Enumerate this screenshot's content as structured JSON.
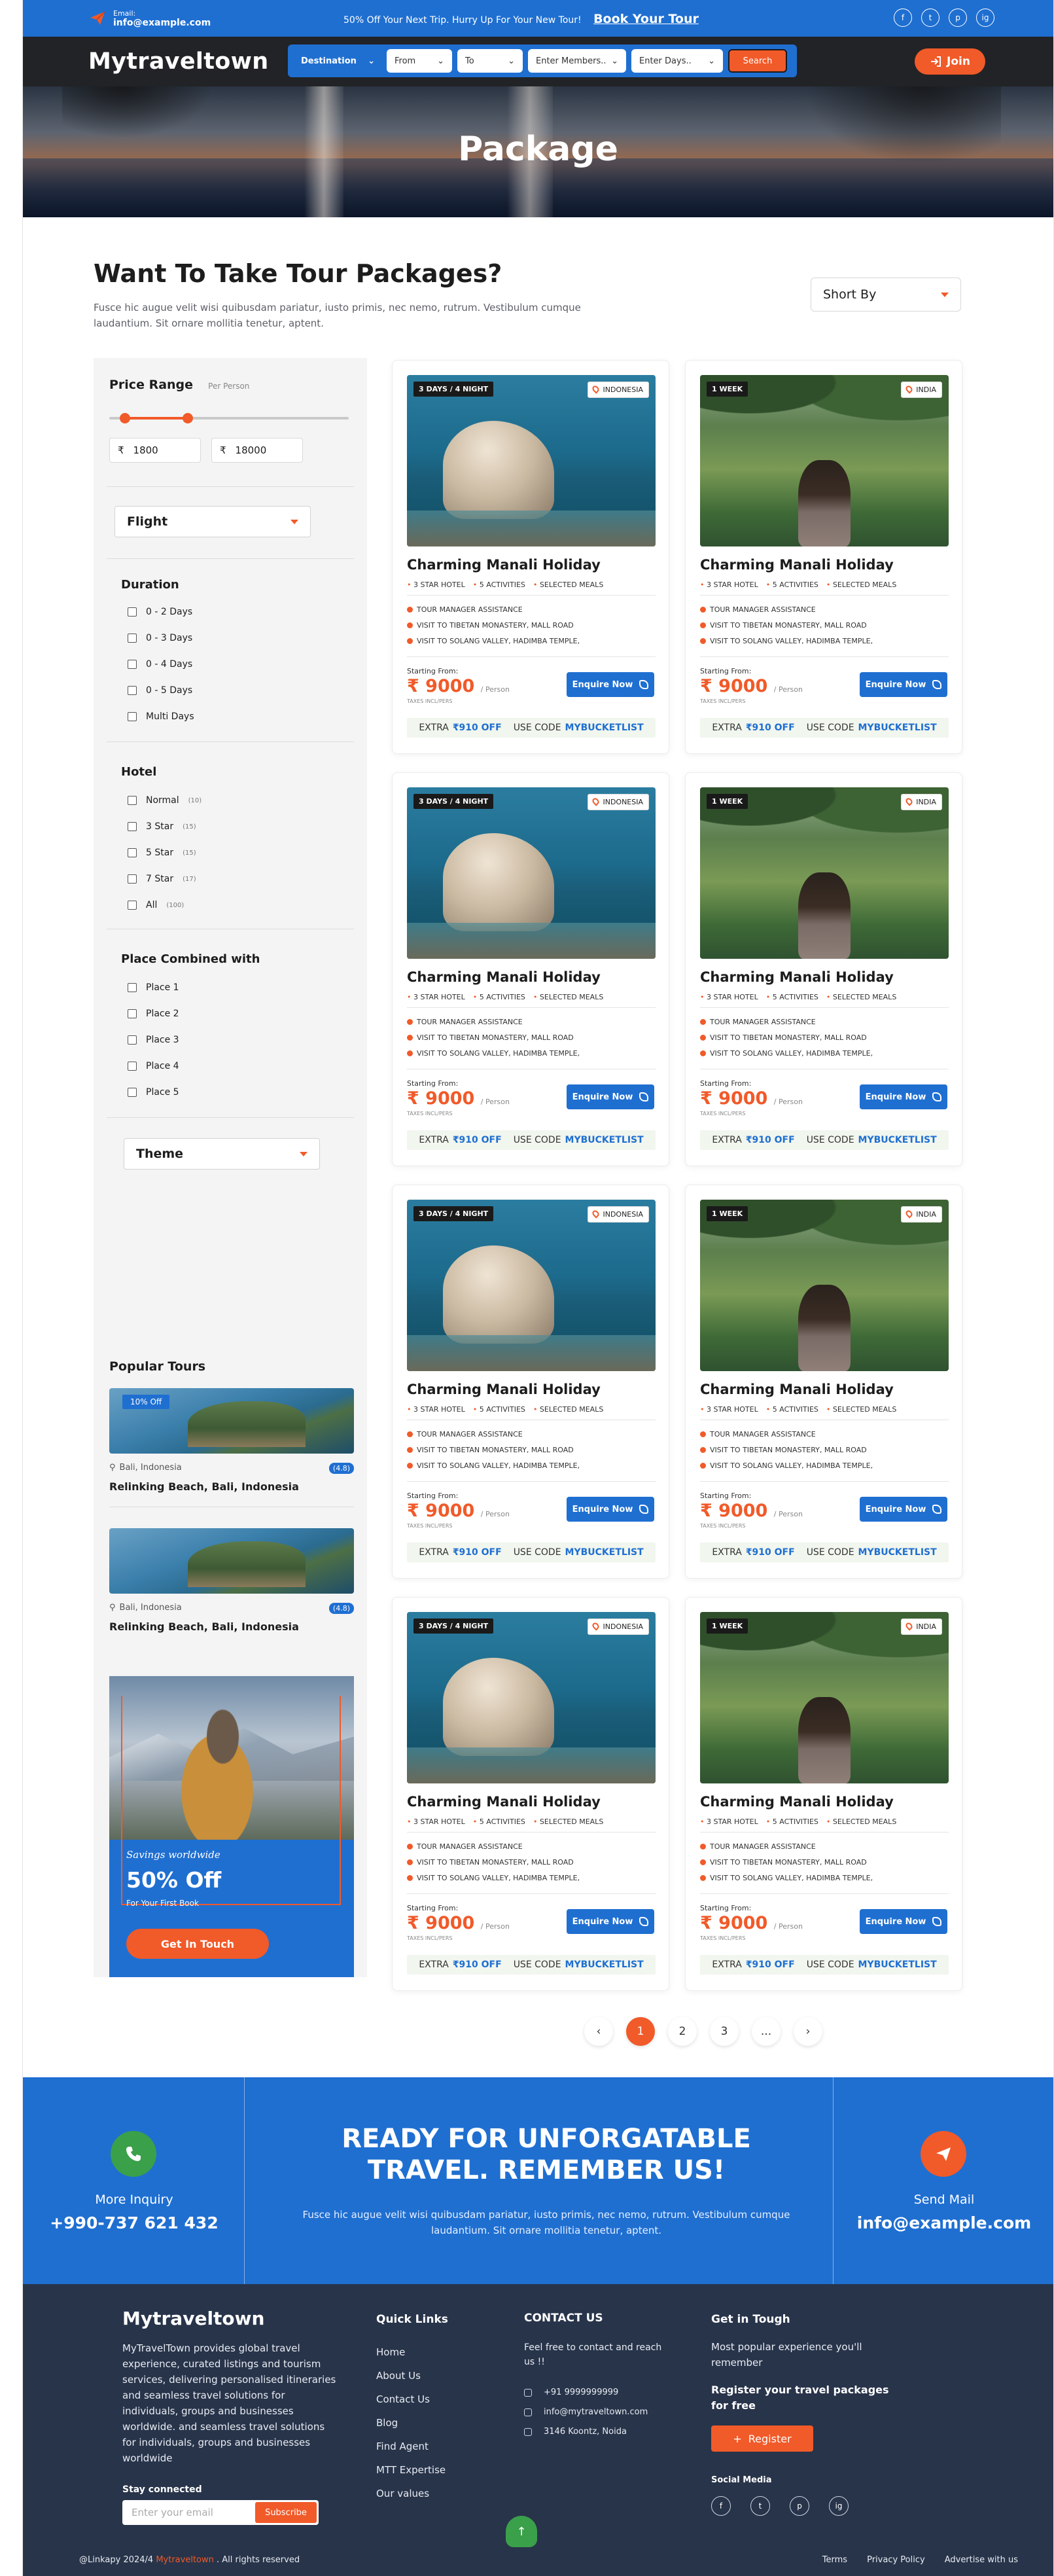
{
  "topbar": {
    "email_label": "Email:",
    "email": "info@example.com",
    "promo": "50% Off Your Next Trip. Hurry Up For Your New Tour!",
    "book": "Book Your Tour",
    "socials": [
      "f",
      "t",
      "p",
      "ig"
    ]
  },
  "header": {
    "logo": "Mytraveltown",
    "search": {
      "destination": "Destination",
      "from": "From",
      "to": "To",
      "members": "Enter Members..",
      "days": "Enter Days..",
      "button": "Search"
    },
    "join": "Join"
  },
  "hero": {
    "title": "Package"
  },
  "intro": {
    "heading": "Want To Take Tour Packages?",
    "text": "Fusce hic augue velit wisi quibusdam pariatur, iusto primis, nec nemo, rutrum. Vestibulum cumque laudantium. Sit ornare mollitia tenetur, aptent.",
    "sort": "Short By"
  },
  "filters": {
    "price_title": "Price Range",
    "per_person": "Per Person",
    "min": "1800",
    "max": "18000",
    "currency": "₹",
    "flight": "Flight",
    "duration_title": "Duration",
    "durations": [
      "0 - 2  Days",
      "0 - 3  Days",
      "0 - 4  Days",
      "0 - 5  Days",
      "Multi Days"
    ],
    "hotel_title": "Hotel",
    "hotels": [
      {
        "label": "Normal",
        "count": "(10)"
      },
      {
        "label": "3 Star",
        "count": "(15)"
      },
      {
        "label": "5 Star",
        "count": "(15)"
      },
      {
        "label": "7 Star",
        "count": "(17)"
      },
      {
        "label": "All",
        "count": "(100)"
      }
    ],
    "place_title": "Place Combined with",
    "places": [
      "Place 1",
      "Place 2",
      "Place 3",
      "Place 4",
      "Place 5"
    ],
    "theme": "Theme"
  },
  "popular": {
    "title": "Popular Tours",
    "tours": [
      {
        "badge": "10% Off",
        "location": "Bali, Indonesia",
        "rating": "(4.8)",
        "name": "Relinking Beach, Bali, Indonesia"
      },
      {
        "badge": "",
        "location": "Bali, Indonesia",
        "rating": "(4.8)",
        "name": "Relinking Beach, Bali, Indonesia"
      }
    ]
  },
  "promo": {
    "script": "Savings worldwide",
    "big": "50% Off",
    "small": "For Your First Book",
    "button": "Get In Touch"
  },
  "cards": [
    {
      "duration": "3 DAYS / 4 NIGHT",
      "country": "INDONESIA",
      "image": "rock"
    },
    {
      "duration": "1 WEEK",
      "country": "INDIA",
      "image": "palm"
    },
    {
      "duration": "3 DAYS / 4 NIGHT",
      "country": "INDONESIA",
      "image": "rock"
    },
    {
      "duration": "1 WEEK",
      "country": "INDIA",
      "image": "palm"
    },
    {
      "duration": "3 DAYS / 4 NIGHT",
      "country": "INDONESIA",
      "image": "rock"
    },
    {
      "duration": "1 WEEK",
      "country": "INDIA",
      "image": "palm"
    },
    {
      "duration": "3 DAYS / 4 NIGHT",
      "country": "INDONESIA",
      "image": "rock"
    },
    {
      "duration": "1 WEEK",
      "country": "INDIA",
      "image": "palm"
    }
  ],
  "card_common": {
    "title": "Charming Manali Holiday",
    "meta": [
      "3 STAR HOTEL",
      "5 ACTIVITIES",
      "SELECTED MEALS"
    ],
    "features": [
      "TOUR MANAGER ASSISTANCE",
      "VISIT TO TIBETAN MONASTERY, MALL ROAD",
      "VISIT TO SOLANG VALLEY, HADIMBA TEMPLE,"
    ],
    "starting": "Starting From:",
    "price": "₹ 9000",
    "per": "/ Person",
    "taxes": "TAXES INCL/PERS",
    "enquire": "Enquire Now",
    "offer_extra": "EXTRA",
    "offer_amount": "₹910 OFF",
    "offer_code_label": "USE CODE",
    "offer_code": "MYBUCKETLIST"
  },
  "pagination": [
    "‹",
    "1",
    "2",
    "3",
    "...",
    "›"
  ],
  "cta": {
    "inquiry_label": "More Inquiry",
    "phone": "+990-737 621 432",
    "heading_line1": "READY FOR UNFORGATABLE",
    "heading_line2": "TRAVEL. REMEMBER US!",
    "text": "Fusce hic augue velit wisi quibusdam pariatur, iusto primis, nec nemo, rutrum. Vestibulum cumque laudantium. Sit ornare mollitia tenetur, aptent.",
    "mail_label": "Send Mail",
    "mail": "info@example.com"
  },
  "footer": {
    "brand": "Mytraveltown",
    "about": "MyTravelTown provides global travel experience, curated listings and tourism services, delivering personalised itineraries and seamless travel solutions for individuals, groups and businesses worldwide.  and seamless travel solutions for individuals, groups and businesses worldwide",
    "stay": "Stay connected",
    "subscribe_placeholder": "Enter your email",
    "subscribe": "Subscribe",
    "quick_title": "Quick Links",
    "quick": [
      "Home",
      "About Us",
      "Contact Us",
      "Blog",
      "Find Agent",
      "MTT Expertise",
      "Our values"
    ],
    "contact_title": "CONTACT US",
    "contact_text": "Feel free to contact and reach us !!",
    "phone": "+91 9999999999",
    "email": "info@mytraveltown.com",
    "address": "3146 Koontz, Noida",
    "tough_title": "Get in Tough",
    "tough_text": "Most popular experience you'll remember",
    "tough_bold": "Register your travel packages for free",
    "register": "Register",
    "social_title": "Social Media",
    "copyright_prefix": "@Linkapy 2024/4",
    "copyright_brand": "Mytraveltown",
    "copyright_suffix": ". All rights reserved",
    "bottom_links": [
      "Terms",
      "Privacy Policy",
      "Advertise with us"
    ]
  }
}
